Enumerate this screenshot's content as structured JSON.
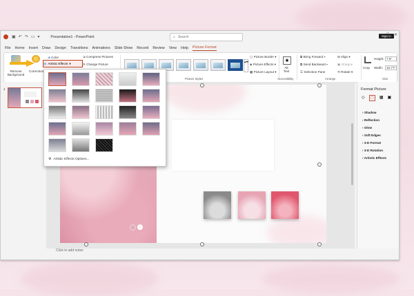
{
  "titlebar": {
    "app_title": "Presentation1 - PowerPoint",
    "search_placeholder": "Search",
    "signin_label": "Sign in"
  },
  "menu": [
    "File",
    "Home",
    "Insert",
    "Draw",
    "Design",
    "Transitions",
    "Animations",
    "Slide Show",
    "Record",
    "Review",
    "View",
    "Help",
    "Picture Format"
  ],
  "ribbon": {
    "remove_bg": "Remove Background",
    "corrections": "Corrections",
    "color": "Color",
    "artistic_effects": "Artistic Effects",
    "compress": "Compress Pictures",
    "change": "Change Picture",
    "reset": "Reset Picture",
    "picture_styles_label": "Picture Styles",
    "picture_border": "Picture Border",
    "picture_effects": "Picture Effects",
    "picture_layout": "Picture Layout",
    "alt_text": "Alt Text",
    "accessibility_label": "Accessibility",
    "bring_forward": "Bring Forward",
    "send_backward": "Send Backward",
    "selection_pane": "Selection Pane",
    "align": "Align",
    "group": "Group",
    "rotate": "Rotate",
    "arrange_label": "Arrange",
    "crop": "Crop",
    "height_label": "Height:",
    "height_value": "7.5\"",
    "width_label": "Width:",
    "width_value": "10.77\"",
    "size_label": "Size"
  },
  "slide_number": "1",
  "notes_placeholder": "Click to add notes",
  "dropdown": {
    "options_label": "Artistic Effects Options..."
  },
  "format_pane": {
    "title": "Format Picture",
    "items": [
      "Shadow",
      "Reflection",
      "Glow",
      "Soft Edges",
      "3-D Format",
      "3-D Rotation",
      "Artistic Effects"
    ]
  },
  "colors": {
    "accent": "#b7472a",
    "cloud_pink": "#e7a4b3",
    "gray_square": "#8a8a8a",
    "red_square": "#e0566d"
  }
}
